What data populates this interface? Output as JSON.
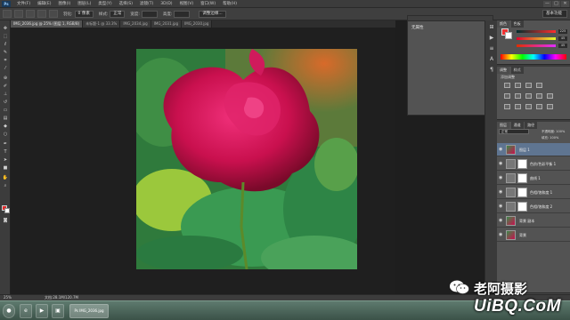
{
  "menubar": {
    "logo": "Ps",
    "items": [
      "文件(F)",
      "编辑(E)",
      "图像(I)",
      "图层(L)",
      "类型(Y)",
      "选择(S)",
      "滤镜(T)",
      "3D(D)",
      "视图(V)",
      "窗口(W)",
      "帮助(H)"
    ],
    "window_controls": [
      "—",
      "□",
      "✕"
    ]
  },
  "options_bar": {
    "feather_label": "羽化:",
    "feather_value": "0 像素",
    "style_label": "样式:",
    "style_value": "正常",
    "width_label": "宽度:",
    "height_label": "高度:",
    "refine_edge": "调整边缘...",
    "workspace": "基本功能"
  },
  "tabs": [
    {
      "label": "IMG_2036.jpg @ 25% (图层 1, RGB/8)",
      "active": true
    },
    {
      "label": "未标题-1 @ 33.3%",
      "active": false
    },
    {
      "label": "IMG_2034.jpg",
      "active": false
    },
    {
      "label": "IMG_2031.jpg",
      "active": false
    },
    {
      "label": "IMG_2030.jpg",
      "active": false
    }
  ],
  "properties_panel": {
    "label": "无属性"
  },
  "color_panel": {
    "tabs": [
      "颜色",
      "色板"
    ],
    "r": "225",
    "g": "45",
    "b": "45"
  },
  "adjustments_panel": {
    "tabs": [
      "调整",
      "样式"
    ],
    "title": "添加调整"
  },
  "layers_panel": {
    "tabs": [
      "图层",
      "通道",
      "路径"
    ],
    "blend_mode": "正常",
    "opacity_label": "不透明度: 100%",
    "fill_label": "填充: 100%",
    "layers": [
      {
        "name": "图层 1",
        "selected": true,
        "has_mask": false
      },
      {
        "name": "色阶/色彩平衡 1",
        "selected": false,
        "has_mask": true
      },
      {
        "name": "曲线 1",
        "selected": false,
        "has_mask": true
      },
      {
        "name": "色相/饱和度 1",
        "selected": false,
        "has_mask": true
      },
      {
        "name": "色相/饱和度 2",
        "selected": false,
        "has_mask": true
      },
      {
        "name": "背景 副本",
        "selected": false,
        "has_mask": false
      },
      {
        "name": "背景",
        "selected": false,
        "has_mask": false
      }
    ]
  },
  "status_bar": {
    "zoom": "25%",
    "doc_size": "文档:28.1M/120.7M"
  },
  "taskbar": {
    "items": [
      "●",
      "e",
      "▶",
      "▣",
      "Ps"
    ],
    "active_label": "Ps IMG_2036.jpg"
  },
  "watermark": {
    "text": "老阿摄影",
    "url": "UiBQ.CoM"
  },
  "colors": {
    "fg": "#e12c2c",
    "bg": "#ffffff",
    "panel": "#535353",
    "selected_layer": "#5f7591"
  }
}
